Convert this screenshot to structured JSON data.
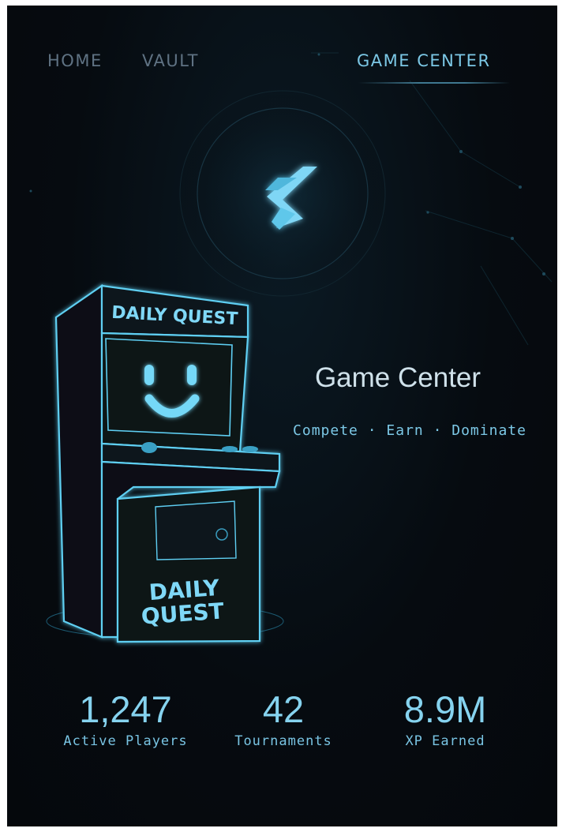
{
  "nav": {
    "items": [
      {
        "label": "HOME"
      },
      {
        "label": "VAULT"
      },
      {
        "label": "GAME CENTER"
      }
    ],
    "active_index": 2
  },
  "logo": {
    "icon": "stylized-s-logo-icon"
  },
  "arcade": {
    "marquee_text": "DAILY QUEST",
    "cabinet_text_line1": "DAILY",
    "cabinet_text_line2": "QUEST",
    "screen_icon": "smiley-face-icon"
  },
  "hero": {
    "title": "Game Center",
    "subtitle": "Compete · Earn · Dominate"
  },
  "stats": [
    {
      "value": "1,247",
      "label": "Active Players"
    },
    {
      "value": "42",
      "label": "Tournaments"
    },
    {
      "value": "8.9M",
      "label": "XP Earned"
    }
  ],
  "colors": {
    "accent": "#7cc8e6",
    "glow": "#4fc6ee",
    "background": "#05080c",
    "nav_inactive": "#5f7283"
  }
}
